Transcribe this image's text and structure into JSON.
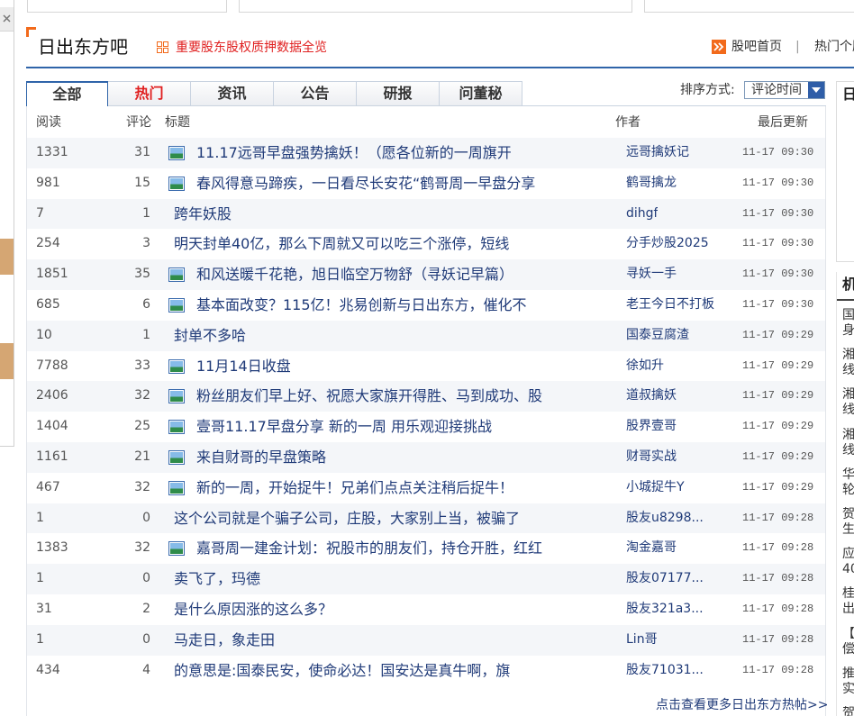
{
  "header": {
    "title": "日出东方吧",
    "promo_link": "重要股东股权质押数据全览",
    "nav": {
      "home": "股吧首页",
      "separator": "|",
      "hot": "热门个股"
    }
  },
  "tabs": [
    {
      "label": "全部",
      "active": true
    },
    {
      "label": "热门",
      "hot": true
    },
    {
      "label": "资讯"
    },
    {
      "label": "公告"
    },
    {
      "label": "研报"
    },
    {
      "label": "问董秘"
    }
  ],
  "sort": {
    "label": "排序方式:",
    "selected": "评论时间"
  },
  "table": {
    "columns": {
      "read": "阅读",
      "comment": "评论",
      "title": "标题",
      "author": "作者",
      "updated": "最后更新"
    },
    "rows": [
      {
        "read": "1331",
        "comment": "31",
        "has_image": true,
        "title": "11.17远哥早盘强势擒妖！（愿各位新的一周旗开",
        "author": "远哥擒妖记",
        "updated": "11-17 09:30"
      },
      {
        "read": "981",
        "comment": "15",
        "has_image": true,
        "title": "春风得意马蹄疾，一日看尽长安花“鹤哥周一早盘分享",
        "author": "鹤哥擒龙",
        "updated": "11-17 09:30"
      },
      {
        "read": "7",
        "comment": "1",
        "has_image": false,
        "title": "跨年妖股",
        "author": "dihgf",
        "updated": "11-17 09:30"
      },
      {
        "read": "254",
        "comment": "3",
        "has_image": false,
        "title": "明天封单40亿，那么下周就又可以吃三个涨停，短线",
        "author": "分手炒股2025",
        "updated": "11-17 09:30"
      },
      {
        "read": "1851",
        "comment": "35",
        "has_image": true,
        "title": "和风送暖千花艳，旭日临空万物舒（寻妖记早篇）",
        "author": "寻妖一手",
        "updated": "11-17 09:30"
      },
      {
        "read": "685",
        "comment": "6",
        "has_image": true,
        "title": "基本面改变？115亿！兆易创新与日出东方，催化不",
        "author": "老王今日不打板",
        "updated": "11-17 09:30"
      },
      {
        "read": "10",
        "comment": "1",
        "has_image": false,
        "title": "封单不多哈",
        "author": "国泰豆腐渣",
        "updated": "11-17 09:29"
      },
      {
        "read": "7788",
        "comment": "33",
        "has_image": true,
        "title": "11月14日收盘",
        "author": "徐如升",
        "updated": "11-17 09:29"
      },
      {
        "read": "2406",
        "comment": "32",
        "has_image": true,
        "title": "粉丝朋友们早上好、祝愿大家旗开得胜、马到成功、股",
        "author": "道叔擒妖",
        "updated": "11-17 09:29"
      },
      {
        "read": "1404",
        "comment": "25",
        "has_image": true,
        "title": "壹哥11.17早盘分享 新的一周 用乐观迎接挑战",
        "author": "股界壹哥",
        "updated": "11-17 09:29"
      },
      {
        "read": "1161",
        "comment": "21",
        "has_image": true,
        "title": "来自财哥的早盘策略",
        "author": "财哥实战",
        "updated": "11-17 09:29"
      },
      {
        "read": "467",
        "comment": "32",
        "has_image": true,
        "title": "新的一周，开始捉牛！兄弟们点点关注稍后捉牛！",
        "author": "小城捉牛Y",
        "updated": "11-17 09:29"
      },
      {
        "read": "1",
        "comment": "0",
        "has_image": false,
        "title": "这个公司就是个骗子公司，庄股，大家别上当，被骗了",
        "author": "股友u8298...",
        "updated": "11-17 09:28"
      },
      {
        "read": "1383",
        "comment": "32",
        "has_image": true,
        "title": "嘉哥周一建金计划：祝股市的朋友们，持仓开胜，红红",
        "author": "淘金嘉哥",
        "updated": "11-17 09:28"
      },
      {
        "read": "1",
        "comment": "0",
        "has_image": false,
        "title": "卖飞了，玛德",
        "author": "股友07177...",
        "updated": "11-17 09:28"
      },
      {
        "read": "31",
        "comment": "2",
        "has_image": false,
        "title": "是什么原因涨的这么多？",
        "author": "股友321a3...",
        "updated": "11-17 09:28"
      },
      {
        "read": "1",
        "comment": "0",
        "has_image": false,
        "title": "马走日，象走田",
        "author": "Lin哥",
        "updated": "11-17 09:28"
      },
      {
        "read": "434",
        "comment": "4",
        "has_image": false,
        "title": "的意思是:国泰民安，使命必达！国安达是真牛啊，旗",
        "author": "股友71031...",
        "updated": "11-17 09:28"
      }
    ]
  },
  "footer": {
    "more_link": "点击查看更多日出东方热帖>>"
  },
  "sidebar": {
    "box1_title": "日",
    "box2_title": "机",
    "news_fragments": [
      [
        "国",
        "身"
      ],
      [
        "湘",
        "线"
      ],
      [
        "湘",
        "线"
      ],
      [
        "湘",
        "线"
      ],
      [
        "华",
        "轮"
      ],
      [
        "贺",
        "生"
      ],
      [
        "应",
        "40"
      ],
      [
        "桂",
        "出"
      ],
      [
        "【",
        "偿"
      ],
      [
        "推",
        "实"
      ],
      [
        "贺"
      ]
    ]
  },
  "icons": {
    "header_corner": "corner-mark-icon",
    "promo": "grid-icon",
    "home": "double-chevron-icon",
    "sort_dropdown": "triangle-down-icon",
    "post_image": "image-icon",
    "panel_close": "close-icon"
  },
  "colors": {
    "accent": "#2f64a9",
    "hot_red": "#e02020",
    "brand_orange": "#f26a1b",
    "link_navy": "#1f3a78",
    "stripe": "#f4f6f9"
  }
}
